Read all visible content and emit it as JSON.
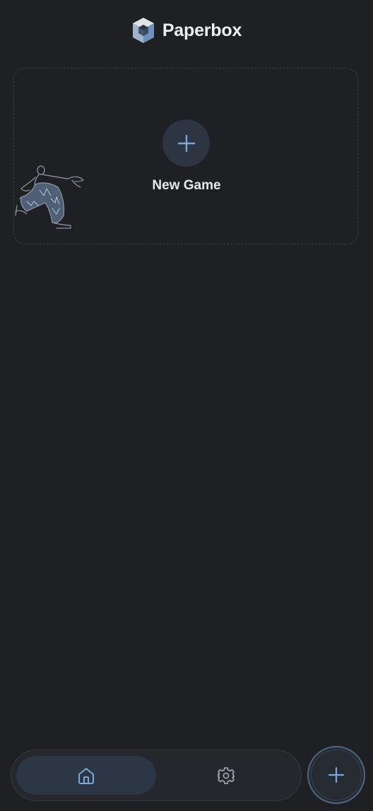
{
  "header": {
    "app_title": "Paperbox",
    "logo_icon": "cube-logo-icon"
  },
  "new_game": {
    "label": "New Game",
    "icon": "plus-icon",
    "illustration": "dancing-person-illustration"
  },
  "bottom_nav": {
    "items": [
      {
        "name": "home",
        "icon": "home-icon",
        "active": true
      },
      {
        "name": "settings",
        "icon": "gear-icon",
        "active": false
      }
    ]
  },
  "fab": {
    "icon": "plus-icon"
  },
  "colors": {
    "background": "#1f2024",
    "accent": "#7aa6db",
    "nav_active": "#2c3644",
    "card_border": "#3a3d44"
  }
}
